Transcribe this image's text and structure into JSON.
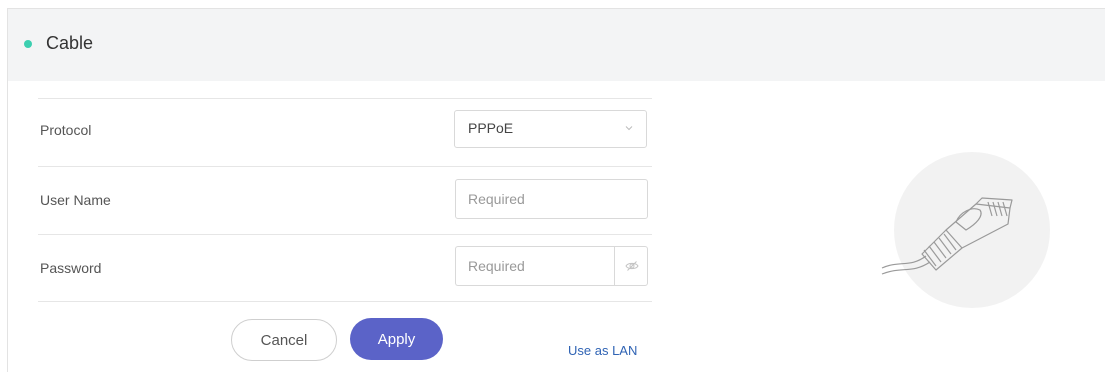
{
  "header": {
    "title": "Cable",
    "status_color": "#3ccfb0"
  },
  "form": {
    "protocol": {
      "label": "Protocol",
      "value": "PPPoE"
    },
    "username": {
      "label": "User Name",
      "placeholder": "Required"
    },
    "password": {
      "label": "Password",
      "placeholder": "Required"
    }
  },
  "actions": {
    "cancel_label": "Cancel",
    "apply_label": "Apply",
    "lan_link": "Use as LAN"
  },
  "colors": {
    "accent": "#5b63c8",
    "link": "#2f63b4"
  },
  "icons": {
    "protocol_select": "chevron-down-icon",
    "password_toggle": "eye-slash-icon",
    "illustration": "ethernet-cable-icon"
  }
}
